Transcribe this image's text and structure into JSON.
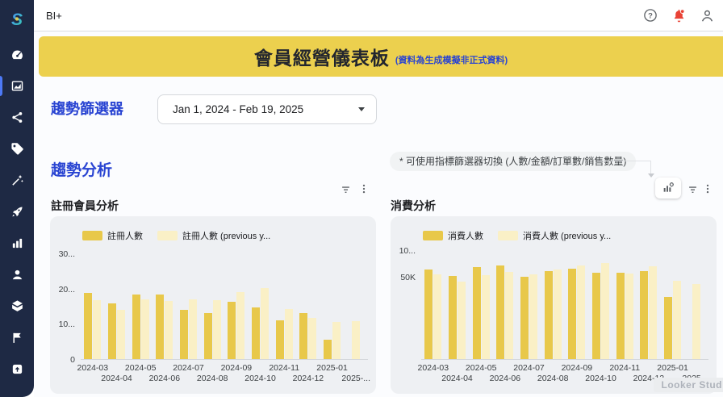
{
  "app": {
    "product_label": "BI+"
  },
  "topbar": {
    "icons": [
      "help-icon",
      "notifications-icon",
      "account-icon"
    ]
  },
  "sidebar": {
    "logo": "s-logo",
    "items": [
      "dashboard-icon",
      "area-chart-icon",
      "share-icon",
      "tag-icon",
      "magic-wand-icon",
      "rocket-icon",
      "bar-chart-icon",
      "user-icon",
      "package-icon",
      "flag-icon",
      "upload-icon"
    ],
    "active_index": 1
  },
  "banner": {
    "title": "會員經營儀表板",
    "subtitle": "(資料為生成模擬非正式資料)"
  },
  "filter": {
    "label": "趨勢篩選器",
    "date_range": "Jan 1, 2024 - Feb 19, 2025"
  },
  "section": {
    "title": "趨勢分析",
    "note": "* 可使用指標篩選器切換 (人數/金額/訂單數/銷售數量)"
  },
  "toolbars": {
    "left_chart": [
      "filter-icon",
      "more-options-icon"
    ],
    "right_chart": [
      "chart-config-icon",
      "filter-icon",
      "more-options-icon"
    ]
  },
  "watermark": "Looker Stud",
  "colors": {
    "sidebar_bg": "#1e2944",
    "accent_blue": "#2944d2",
    "active_indicator": "#4d79f6",
    "banner_yellow": "#ecd04e",
    "bar_current": "#e8c84a",
    "bar_previous": "#faf0c6",
    "notification_red": "#e94235",
    "card_bg": "#eef0f3"
  },
  "chart_data": [
    {
      "type": "bar",
      "title": "註冊會員分析",
      "categories": [
        "2024-03",
        "2024-04",
        "2024-05",
        "2024-06",
        "2024-07",
        "2024-08",
        "2024-09",
        "2024-10",
        "2024-11",
        "2024-12",
        "2025-01",
        "2025-..."
      ],
      "series": [
        {
          "name": "註冊人數",
          "color": "#e8c84a",
          "values": [
            18.8,
            15.9,
            18.3,
            18.3,
            14.0,
            13.1,
            16.3,
            14.7,
            11.1,
            13.1,
            5.4,
            null
          ]
        },
        {
          "name": "註冊人數 (previous y...",
          "color": "#faf0c6",
          "values": [
            16.8,
            14.1,
            17.0,
            16.6,
            17.0,
            16.8,
            19.1,
            20.1,
            14.3,
            11.8,
            10.6,
            10.8
          ]
        }
      ],
      "y_ticks": [
        {
          "label": "30...",
          "value": 30
        },
        {
          "label": "20...",
          "value": 20
        },
        {
          "label": "10...",
          "value": 10
        },
        {
          "label": "0",
          "value": 0
        }
      ],
      "axis_max": 31,
      "ylim": [
        0,
        31
      ],
      "xlabel": "",
      "ylabel": "",
      "grid": false,
      "legend_position": "top"
    },
    {
      "type": "bar",
      "title": "消費分析",
      "unit": "K",
      "categories": [
        "2024-03",
        "2024-04",
        "2024-05",
        "2024-06",
        "2024-07",
        "2024-08",
        "2024-09",
        "2024-10",
        "2024-11",
        "2024-12",
        "2025-01",
        "2025-..."
      ],
      "series": [
        {
          "name": "消費人數",
          "color": "#e8c84a",
          "values": [
            54.5,
            50.5,
            55.5,
            56.5,
            50.0,
            53.5,
            55.0,
            52.5,
            52.5,
            53.5,
            37.5,
            null
          ]
        },
        {
          "name": "消費人數 (previous y...",
          "color": "#faf0c6",
          "values": [
            51.5,
            47.0,
            51.0,
            53.0,
            51.5,
            54.5,
            56.5,
            58.0,
            52.0,
            56.0,
            47.5,
            45.5
          ]
        }
      ],
      "y_ticks": [
        {
          "label": "10...",
          "value": 66
        },
        {
          "label": "50K",
          "value": 50
        }
      ],
      "axis_max": 66,
      "ylim": [
        0,
        66
      ],
      "xlabel": "",
      "ylabel": "",
      "grid": false,
      "legend_position": "top"
    }
  ]
}
